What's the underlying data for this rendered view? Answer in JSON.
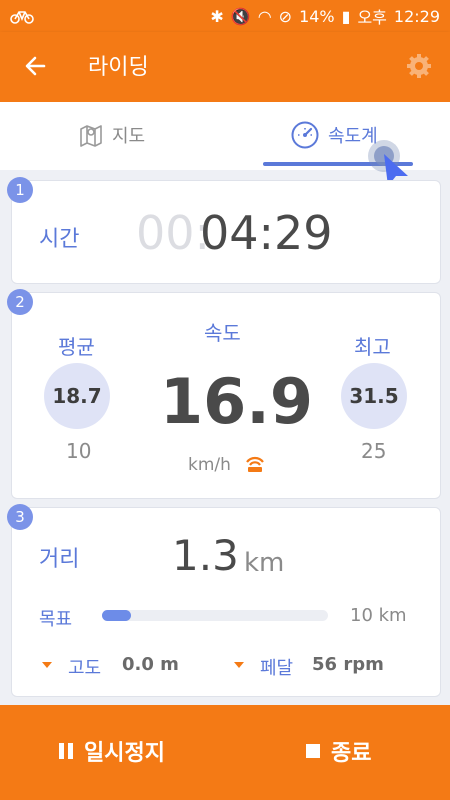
{
  "status": {
    "battery": "14%",
    "ampm": "오후",
    "time": "12:29"
  },
  "appbar": {
    "title": "라이딩"
  },
  "tabs": {
    "map": "지도",
    "speedometer": "속도계"
  },
  "cards": {
    "time": {
      "badge": "1",
      "label": "시간",
      "ghost": "00:",
      "value": "04:29"
    },
    "speed": {
      "badge": "2",
      "avg_label": "평균",
      "avg_value": "18.7",
      "avg_sub": "10",
      "center_label": "속도",
      "current": "16.9",
      "unit": "km/h",
      "max_label": "최고",
      "max_value": "31.5",
      "max_sub": "25"
    },
    "distance": {
      "badge": "3",
      "label": "거리",
      "value": "1.3",
      "unit": "km",
      "goal_label": "목표",
      "goal_value": "10 km",
      "goal_progress": 0.13,
      "altitude_label": "고도",
      "altitude_value": "0.0 m",
      "cadence_label": "페달",
      "cadence_value": "56 rpm"
    }
  },
  "bottom": {
    "pause": "일시정지",
    "stop": "종료"
  },
  "colors": {
    "accent": "#f47a15",
    "blue": "#5b79d9",
    "badge": "#7b93e8"
  }
}
